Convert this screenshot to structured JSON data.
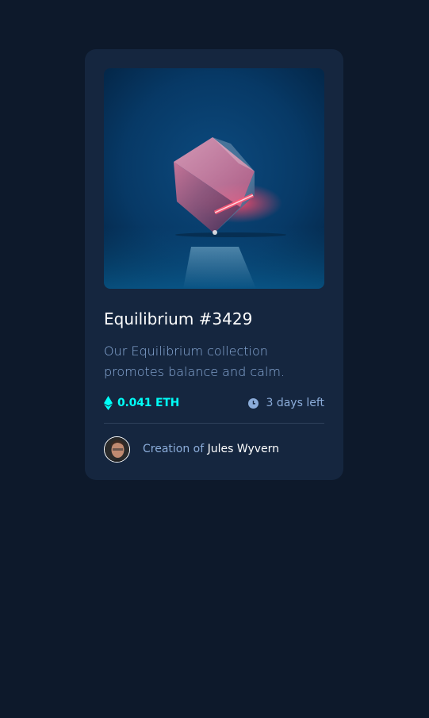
{
  "card": {
    "image_alt": "Equilibrium",
    "title": "Equilibrium #3429",
    "description": "Our Equilibrium collection promotes balance and calm.",
    "price": "0.041 ETH",
    "time_left": "3 days left",
    "creator_prefix": "Creation of ",
    "creator_name": "Jules Wyvern"
  },
  "icons": {
    "price": "ethereum-icon",
    "time": "clock-icon",
    "avatar": "avatar-image"
  },
  "colors": {
    "page_bg": "#0D192B",
    "card_bg": "#15263F",
    "accent_cyan": "#00FFF8",
    "soft_blue": "#8BACD9",
    "white": "#FFFFFF",
    "divider": "#2E405A"
  }
}
